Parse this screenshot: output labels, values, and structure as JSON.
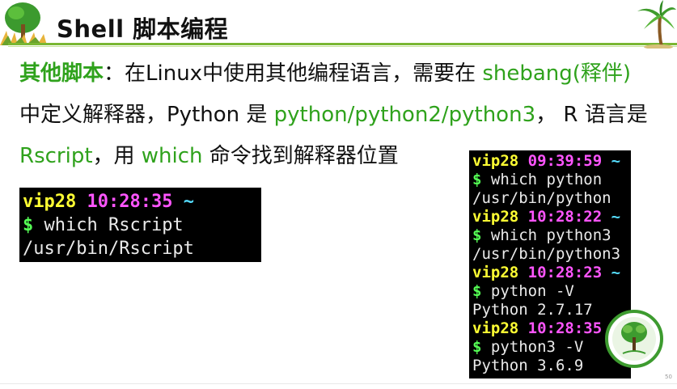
{
  "title": "Shell 脚本编程",
  "paragraph": {
    "lead": "其他脚本",
    "s1": "：在Linux中使用其他编程语言，需要在 ",
    "shebang": "shebang(释伴)",
    "s2": " 中定义解释器，Python 是 ",
    "pythons": "python/python2/python3",
    "s3": "， R 语言是 ",
    "rscript": "Rscript",
    "s4": "，用 ",
    "which": "which",
    "s5": " 命令找到解释器位置"
  },
  "terminal_left": [
    {
      "type": "prompt",
      "user": "vip28",
      "time": "10:28:35",
      "tilde": "~"
    },
    {
      "type": "cmd",
      "dollar": "$",
      "text": " which Rscript"
    },
    {
      "type": "out",
      "text": "/usr/bin/Rscript"
    }
  ],
  "terminal_right": [
    {
      "type": "prompt",
      "user": "vip28",
      "time": "09:39:59",
      "tilde": "~"
    },
    {
      "type": "cmd",
      "dollar": "$",
      "text": " which python"
    },
    {
      "type": "out",
      "text": "/usr/bin/python"
    },
    {
      "type": "prompt",
      "user": "vip28",
      "time": "10:28:22",
      "tilde": "~"
    },
    {
      "type": "cmd",
      "dollar": "$",
      "text": " which python3"
    },
    {
      "type": "out",
      "text": "/usr/bin/python3"
    },
    {
      "type": "prompt",
      "user": "vip28",
      "time": "10:28:23",
      "tilde": "~"
    },
    {
      "type": "cmd",
      "dollar": "$",
      "text": " python -V"
    },
    {
      "type": "out",
      "text": "Python 2.7.17"
    },
    {
      "type": "prompt",
      "user": "vip28",
      "time": "10:28:35",
      "tilde": ""
    },
    {
      "type": "cmd",
      "dollar": "$",
      "text": " python3 -V"
    },
    {
      "type": "out",
      "text": "Python 3.6.9"
    }
  ],
  "page_number": "50",
  "colors": {
    "accent_green": "#2fa21c",
    "rule_green": "#7ab733",
    "prompt_user": "#ffff33",
    "prompt_time": "#ff55ff",
    "prompt_tilde": "#55ddff",
    "prompt_dollar": "#55ff55"
  },
  "icons": {
    "left_decoration": "tree-and-grass-icon",
    "right_decoration": "palm-tree-icon",
    "badge": "tree-seal-badge-icon"
  }
}
